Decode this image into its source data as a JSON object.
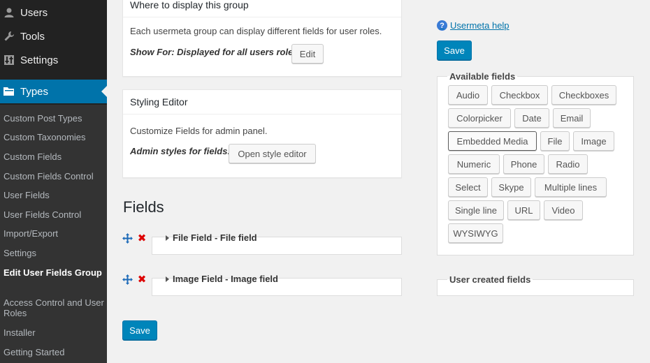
{
  "sidebar": {
    "top_items": [
      {
        "label": "Users",
        "icon": "user-icon"
      },
      {
        "label": "Tools",
        "icon": "wrench-icon"
      },
      {
        "label": "Settings",
        "icon": "settings-icon"
      }
    ],
    "active_item": {
      "label": "Types",
      "icon": "folder-icon"
    },
    "submenu": [
      "Custom Post Types",
      "Custom Taxonomies",
      "Custom Fields",
      "Custom Fields Control",
      "User Fields",
      "User Fields Control",
      "Import/Export",
      "Settings",
      "Edit User Fields Group",
      "Access Control and User Roles",
      "Installer",
      "Getting Started"
    ],
    "current_submenu": "Edit User Fields Group",
    "colors": {
      "bg": "#222222",
      "submenu_bg": "#333333",
      "active": "#0073aa"
    }
  },
  "display_box": {
    "title": "Where to display this group",
    "description": "Each usermeta group can display different fields for user roles.",
    "show_for_label": "Show For: Displayed for all users roles",
    "edit_button": "Edit"
  },
  "styling_box": {
    "title": "Styling Editor",
    "description": "Customize Fields for admin panel.",
    "admin_styles_label": "Admin styles for fields:",
    "open_button": "Open style editor"
  },
  "fields_section": {
    "heading": "Fields",
    "fields": [
      {
        "title": "File Field - File field"
      },
      {
        "title": "Image Field - Image field"
      }
    ],
    "save_button": "Save"
  },
  "right_column": {
    "help_link": "Usermeta help",
    "save_button": "Save",
    "available_fields_legend": "Available fields",
    "available_fields": [
      "Audio",
      "Checkbox",
      "Checkboxes",
      "Colorpicker",
      "Date",
      "Email",
      "Embedded Media",
      "File",
      "Image",
      "Numeric",
      "Phone",
      "Radio",
      "Select",
      "Skype",
      "Multiple lines",
      "Single line",
      "URL",
      "Video",
      "WYSIWYG"
    ],
    "focused_field": "Embedded Media",
    "user_created_legend": "User created fields"
  },
  "colors": {
    "primary": "#0085ba",
    "link": "#0073aa",
    "delete": "#dd0000",
    "move": "#1e6bb8"
  }
}
